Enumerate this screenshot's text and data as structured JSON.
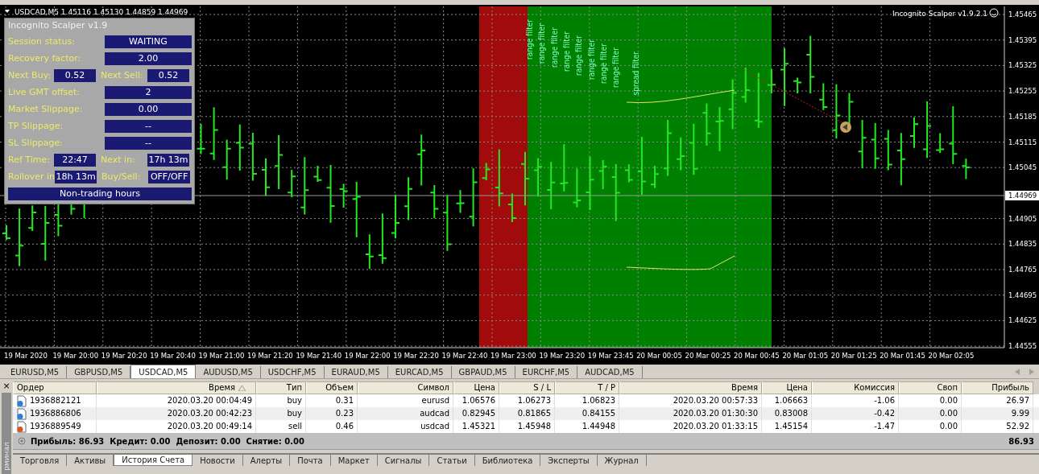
{
  "chart": {
    "title": "USDCAD,M5  1.45116 1.45130 1.44859 1.44969",
    "indicator_name": "Incognito Scalper v1.9.2.1",
    "price_labels": [
      "1.45465",
      "1.45395",
      "1.45325",
      "1.45255",
      "1.45185",
      "1.45115",
      "1.45045",
      "1.44905",
      "1.44835",
      "1.44765",
      "1.44695",
      "1.44625",
      "1.44555"
    ],
    "current_price": "1.44969",
    "time_labels": [
      "19 Mar 2020",
      "19 Mar 20:00",
      "19 Mar 20:20",
      "19 Mar 20:40",
      "19 Mar 21:00",
      "19 Mar 21:20",
      "19 Mar 21:40",
      "19 Mar 22:00",
      "19 Mar 22:20",
      "19 Mar 22:40",
      "19 Mar 23:00",
      "19 Mar 23:20",
      "19 Mar 23:45",
      "20 Mar 00:05",
      "20 Mar 00:25",
      "20 Mar 00:45",
      "20 Mar 01:05",
      "20 Mar 01:25",
      "20 Mar 01:45",
      "20 Mar 02:05"
    ],
    "filter_labels": [
      "range filter",
      "range filter",
      "range filter",
      "range filter",
      "range filter",
      "range filter",
      "range filter",
      "range filter",
      "spread filter"
    ]
  },
  "panel": {
    "title": "Incognito Scalper v1.9",
    "rows": [
      {
        "kind": "wide",
        "label": "Session status:",
        "value": "WAITING"
      },
      {
        "kind": "wide",
        "label": "Recovery factor:",
        "value": "2.00"
      },
      {
        "kind": "pair",
        "label": "Next Buy:",
        "value": "0.52",
        "label2": "Next Sell:",
        "value2": "0.52"
      },
      {
        "kind": "wide",
        "label": "Live GMT offset:",
        "value": "2"
      },
      {
        "kind": "wide",
        "label": "Market Slippage:",
        "value": "0.00"
      },
      {
        "kind": "wide",
        "label": "TP Slippage:",
        "value": "--"
      },
      {
        "kind": "wide",
        "label": "SL Slippage:",
        "value": "--"
      },
      {
        "kind": "pair",
        "label": "Ref Time:",
        "value": "22:47",
        "label2": "Next in:",
        "value2": "17h 13m"
      },
      {
        "kind": "pair",
        "label": "Rollover in",
        "value": "18h 13m",
        "label2": "Buy/Sell:",
        "value2": "OFF/OFF"
      },
      {
        "kind": "banner",
        "value": "Non-trading hours"
      }
    ]
  },
  "symbol_tabs": [
    {
      "label": "EURUSD,M5",
      "selected": false
    },
    {
      "label": "GBPUSD,M5",
      "selected": false
    },
    {
      "label": "USDCAD,M5",
      "selected": true
    },
    {
      "label": "AUDUSD,M5",
      "selected": false
    },
    {
      "label": "USDCHF,M5",
      "selected": false
    },
    {
      "label": "EURAUD,M5",
      "selected": false
    },
    {
      "label": "EURCAD,M5",
      "selected": false
    },
    {
      "label": "GBPAUD,M5",
      "selected": false
    },
    {
      "label": "EURCHF,M5",
      "selected": false
    },
    {
      "label": "AUDCAD,M5",
      "selected": false
    }
  ],
  "terminal": {
    "close_glyph": "×",
    "side_label": "рминал",
    "columns": [
      {
        "label": "Ордер",
        "sorted": false
      },
      {
        "label": "Время",
        "sorted": true
      },
      {
        "label": "Тип",
        "sorted": false
      },
      {
        "label": "Объем",
        "sorted": false
      },
      {
        "label": "Символ",
        "sorted": false
      },
      {
        "label": "Цена",
        "sorted": false
      },
      {
        "label": "S / L",
        "sorted": false
      },
      {
        "label": "T / P",
        "sorted": false
      },
      {
        "label": "Время",
        "sorted": false
      },
      {
        "label": "Цена",
        "sorted": false
      },
      {
        "label": "Комиссия",
        "sorted": false
      },
      {
        "label": "Своп",
        "sorted": false
      },
      {
        "label": "Прибыль",
        "sorted": false
      }
    ],
    "rows": [
      {
        "color": "#2f7fd0",
        "cells": [
          "1936882121",
          "2020.03.20 00:04:49",
          "buy",
          "0.31",
          "eurusd",
          "1.06576",
          "1.06273",
          "1.06823",
          "2020.03.20 00:57:33",
          "1.06663",
          "-1.06",
          "0.00",
          "26.97"
        ]
      },
      {
        "color": "#2f7fd0",
        "cells": [
          "1936886806",
          "2020.03.20 00:42:23",
          "buy",
          "0.23",
          "audcad",
          "0.82945",
          "0.81865",
          "0.84155",
          "2020.03.20 01:30:30",
          "0.83008",
          "-0.42",
          "0.00",
          "9.99"
        ]
      },
      {
        "color": "#d9541e",
        "cells": [
          "1936889549",
          "2020.03.20 00:49:14",
          "sell",
          "0.46",
          "usdcad",
          "1.45321",
          "1.45948",
          "1.44948",
          "2020.03.20 01:33:15",
          "1.45154",
          "-1.47",
          "0.00",
          "52.92"
        ]
      }
    ],
    "summary": "Прибыль: 86.93  Кредит: 0.00  Депозит: 0.00  Снятие: 0.00",
    "summary_total": "86.93"
  },
  "terminal_tabs": [
    {
      "label": "Торговля",
      "selected": false
    },
    {
      "label": "Активы",
      "selected": false
    },
    {
      "label": "История Счета",
      "selected": true
    },
    {
      "label": "Новости",
      "selected": false
    },
    {
      "label": "Алерты",
      "selected": false
    },
    {
      "label": "Почта",
      "selected": false
    },
    {
      "label": "Маркет",
      "selected": false
    },
    {
      "label": "Сигналы",
      "selected": false
    },
    {
      "label": "Статьи",
      "selected": false
    },
    {
      "label": "Библиотека",
      "selected": false
    },
    {
      "label": "Эксперты",
      "selected": false
    },
    {
      "label": "Журнал",
      "selected": false
    }
  ]
}
